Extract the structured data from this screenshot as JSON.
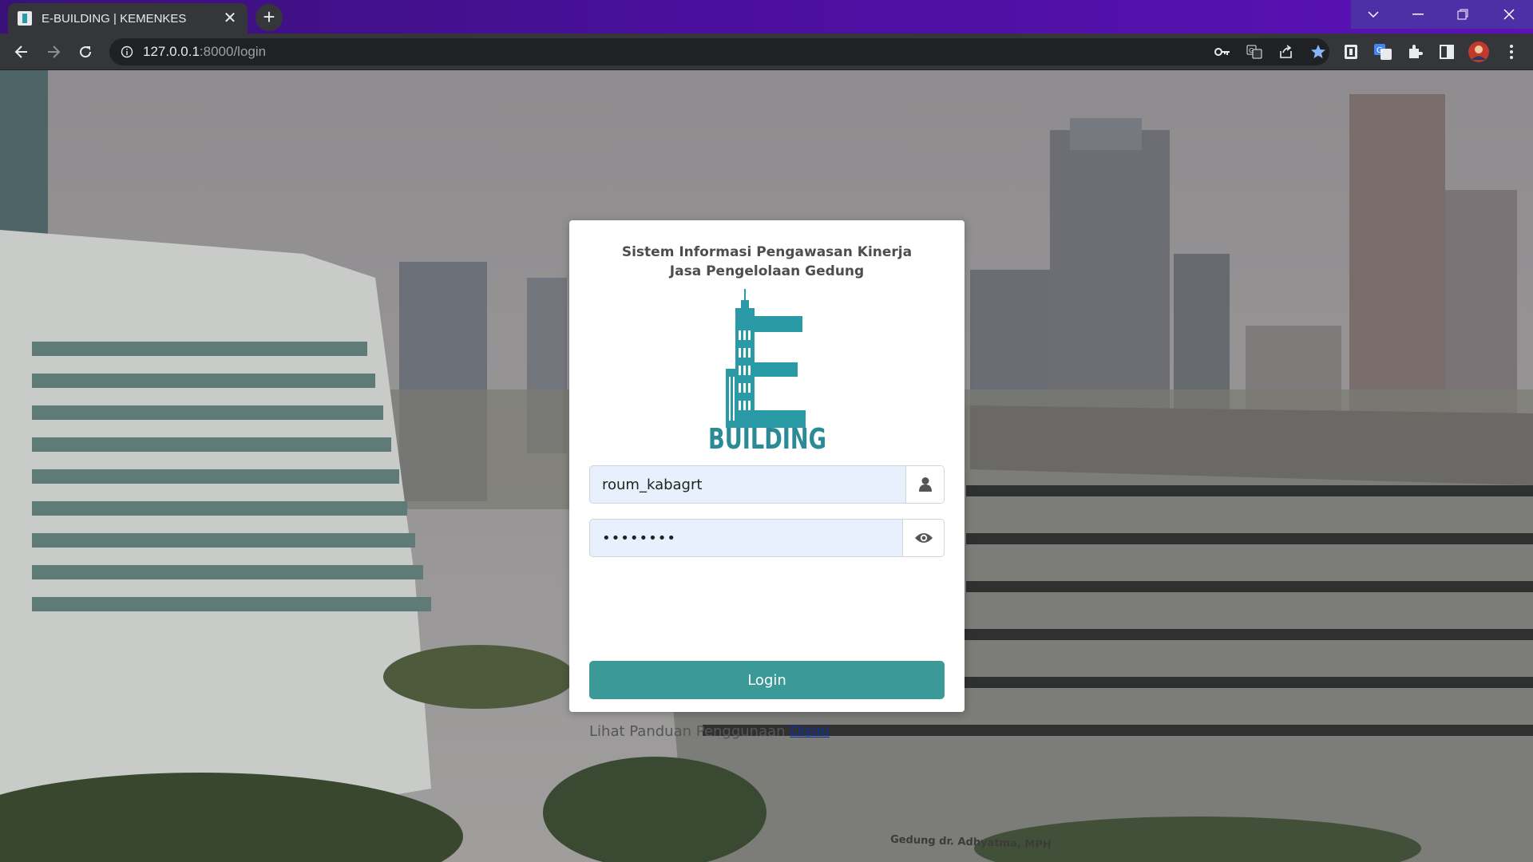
{
  "browser": {
    "tab_title": "E-BUILDING | KEMENKES",
    "tab_close_glyph": "✕",
    "new_tab_glyph": "+",
    "url_host": "127.0.0.1",
    "url_rest": ":8000/login",
    "theme_color": "#4a0f9c",
    "icons": [
      "back-icon",
      "forward-icon",
      "reload-icon",
      "site-info-icon",
      "key-icon",
      "translate-icon",
      "share-icon",
      "bookmark-star-icon",
      "extension-icon",
      "translate-extension-icon",
      "puzzle-icon",
      "side-panel-icon",
      "profile-avatar",
      "menu-icon"
    ]
  },
  "login": {
    "title_line1": "Sistem Informasi Pengawasan Kinerja",
    "title_line2": "Jasa Pengelolaan Gedung",
    "logo_text": "BUILDING",
    "username_value": "roum_kabagrt",
    "password_value": "••••••••",
    "login_label": "Login",
    "guide_text": "Lihat Panduan Penggunaan ",
    "guide_link": "Disini",
    "accent_color": "#3b9a98",
    "logo_color": "#2a9aa6"
  },
  "background": {
    "building_sign": "Gedung dr. Adhyatma, MPH"
  }
}
